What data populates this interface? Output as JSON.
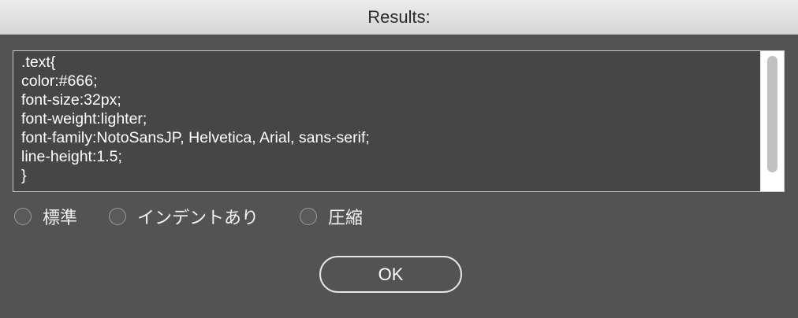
{
  "window": {
    "title": "Results:"
  },
  "output": {
    "lines": [
      ".text{",
      "color:#666;",
      "font-size:32px;",
      "font-weight:lighter;",
      "font-family:NotoSansJP, Helvetica, Arial, sans-serif;",
      "line-height:1.5;",
      "}"
    ]
  },
  "format_options": [
    {
      "label": "標準",
      "selected": false
    },
    {
      "label": "インデントあり",
      "selected": false
    },
    {
      "label": "圧縮",
      "selected": false
    }
  ],
  "buttons": {
    "ok_label": "OK"
  },
  "colors": {
    "window_bg": "#535353",
    "textarea_bg": "#464646",
    "text": "#ffffff"
  }
}
